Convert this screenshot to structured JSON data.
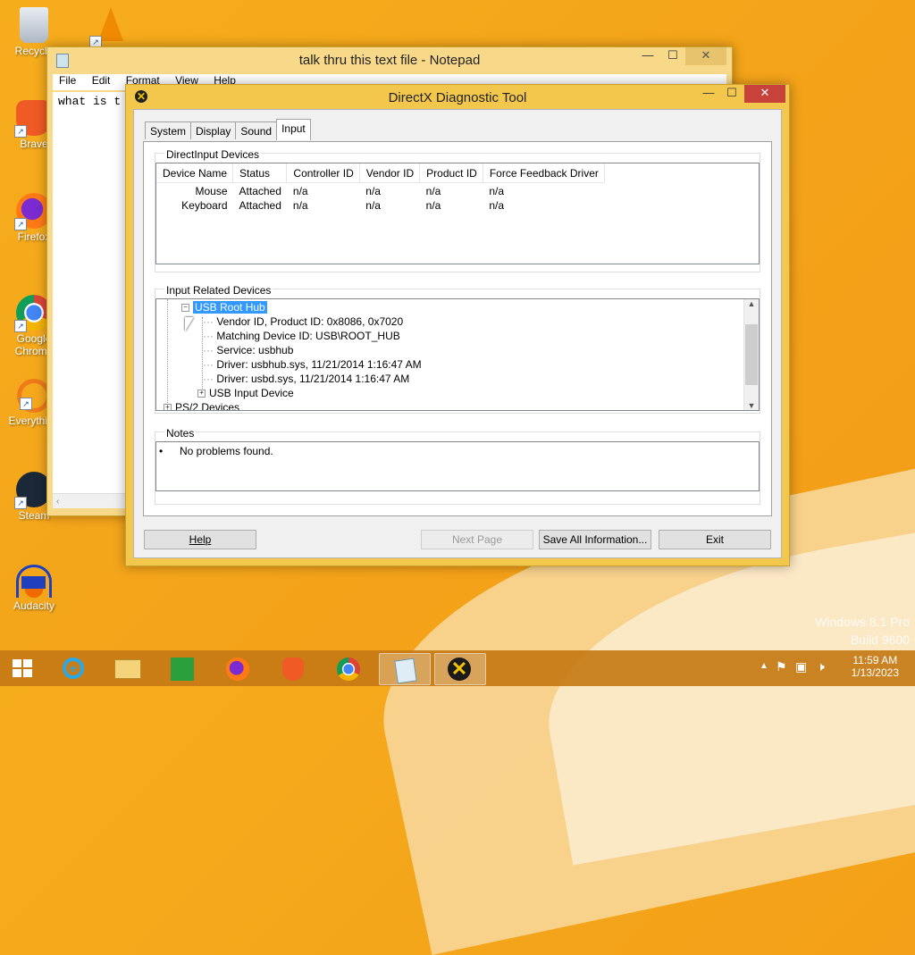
{
  "watermark": {
    "line1": "Windows 8.1 Pro",
    "line2": "Build 9600"
  },
  "desktop_icons": [
    {
      "label": "Recycle",
      "icon": "recycle-bin-icon",
      "color": "#cfd6df"
    },
    {
      "label": "Brave",
      "icon": "brave-icon",
      "color": "#f05a24"
    },
    {
      "label": "Firefox",
      "icon": "firefox-icon",
      "color": "#e66000"
    },
    {
      "label": "Google Chrome",
      "icon": "chrome-icon",
      "color": "#4285f4"
    },
    {
      "label": "Everything",
      "icon": "everything-icon",
      "color": "#ef7a1a"
    },
    {
      "label": "Steam",
      "icon": "steam-icon",
      "color": "#1b2838"
    },
    {
      "label": "Audacity",
      "icon": "audacity-icon",
      "color": "#1f3fbf"
    }
  ],
  "notepad": {
    "title": "talk thru this text file - Notepad",
    "menu": [
      "File",
      "Edit",
      "Format",
      "View",
      "Help"
    ],
    "text": "what is t"
  },
  "dxdiag": {
    "title": "DirectX Diagnostic Tool",
    "tabs": [
      "System",
      "Display",
      "Sound",
      "Input"
    ],
    "active_tab": "Input",
    "directinput_label": "DirectInput Devices",
    "columns": [
      "Device Name",
      "Status",
      "Controller ID",
      "Vendor ID",
      "Product ID",
      "Force Feedback Driver"
    ],
    "devices": [
      [
        "Mouse",
        "Attached",
        "n/a",
        "n/a",
        "n/a",
        "n/a"
      ],
      [
        "Keyboard",
        "Attached",
        "n/a",
        "n/a",
        "n/a",
        "n/a"
      ]
    ],
    "related_label": "Input Related Devices",
    "tree": {
      "root_selected": "USB Root Hub",
      "children": [
        "Vendor ID, Product ID: 0x8086, 0x7020",
        "Matching Device ID: USB\\ROOT_HUB",
        "Service: usbhub",
        "Driver: usbhub.sys, 11/21/2014 1:16:47 AM",
        "Driver: usbd.sys, 11/21/2014 1:16:47 AM"
      ],
      "collapsed_child": "USB Input Device",
      "next_root": "PS/2 Devices"
    },
    "notes_label": "Notes",
    "notes": [
      "No problems found."
    ],
    "buttons": {
      "help": "Help",
      "next": "Next Page",
      "save": "Save All Information...",
      "exit": "Exit"
    }
  },
  "taskbar": {
    "items": [
      "start-icon",
      "internet-explorer-icon",
      "file-explorer-icon",
      "store-icon",
      "firefox-icon",
      "brave-icon",
      "chrome-icon",
      "notepad-icon",
      "dxdiag-icon"
    ],
    "time": "11:59 AM",
    "date": "1/13/2023"
  }
}
